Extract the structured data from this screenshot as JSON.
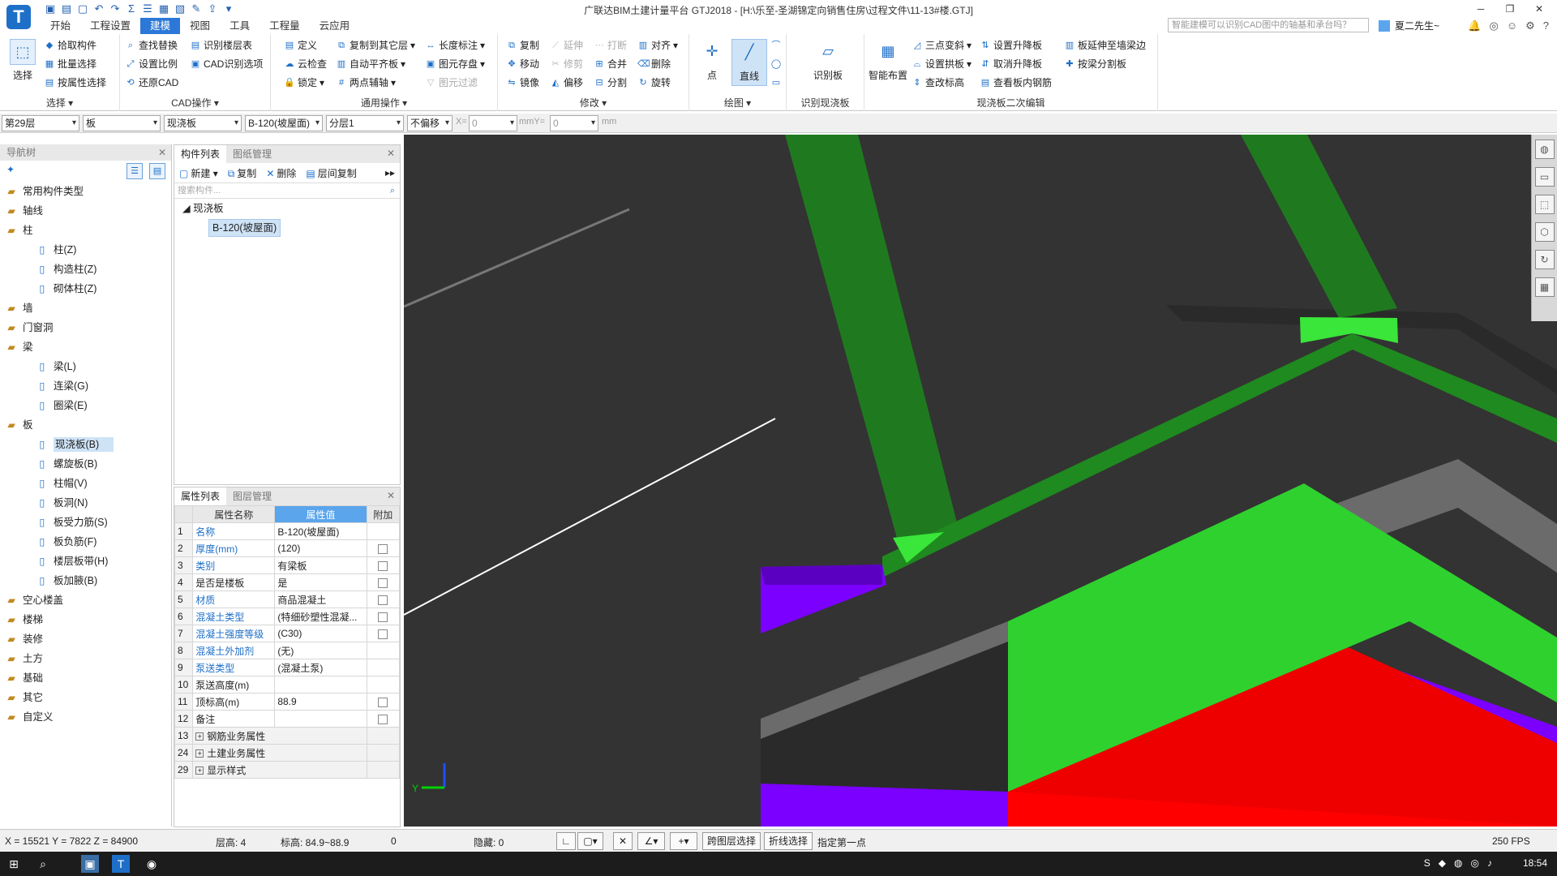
{
  "title": "广联达BIM土建计量平台 GTJ2018 - [H:\\乐至-圣湖锦定向销售住房\\过程文件\\11-13#楼.GTJ]",
  "logo": "T",
  "qat_icons": [
    "save-icon",
    "open-icon",
    "new-icon",
    "undo-icon",
    "redo-icon",
    "sum-icon",
    "list-icon",
    "calc-icon",
    "report-icon",
    "edit-icon",
    "export-icon",
    "more-icon"
  ],
  "menu_tabs": [
    "开始",
    "工程设置",
    "建模",
    "视图",
    "工具",
    "工程量",
    "云应用"
  ],
  "active_tab": "建模",
  "search_placeholder": "智能建模可以识别CAD图中的轴基和承台吗？",
  "user_name": "夏二先生~",
  "ribbon": {
    "select": {
      "label": "选择",
      "big": "选择",
      "items": [
        "拾取构件",
        "批量选择",
        "按属性选择"
      ]
    },
    "cad": {
      "label": "CAD操作",
      "items": [
        "查找替换",
        "设置比例",
        "还原CAD",
        "识别楼层表",
        "CAD识别选项"
      ]
    },
    "common": {
      "label": "通用操作",
      "items": [
        "定义",
        "云检查",
        "锁定",
        "复制到其它层",
        "自动平齐板",
        "两点辅轴",
        "长度标注",
        "图元存盘",
        "图元过滤"
      ]
    },
    "modify": {
      "label": "修改",
      "items": [
        "复制",
        "移动",
        "镜像",
        "延伸",
        "修剪",
        "偏移",
        "打断",
        "合并",
        "分割",
        "对齐",
        "删除",
        "旋转"
      ]
    },
    "draw": {
      "label": "绘图",
      "point": "点",
      "line": "直线"
    },
    "identify": {
      "label": "识别现浇板",
      "big": "识别板"
    },
    "edit2": {
      "label": "现浇板二次编辑",
      "big": "智能布置",
      "items": [
        "三点变斜",
        "设置拱板",
        "查改标高",
        "设置升降板",
        "取消升降板",
        "查看板内钢筋",
        "板延伸至墙梁边",
        "按梁分割板"
      ]
    }
  },
  "filter": {
    "floor": "第29层",
    "type": "板",
    "subtype": "现浇板",
    "component": "B-120(坡屋面)",
    "layer": "分层1",
    "offset": "不偏移",
    "x_label": "X=",
    "x_val": "0",
    "y_label": "mmY=",
    "y_val": "0",
    "mm": "mm"
  },
  "nav": {
    "title": "导航树",
    "items": [
      {
        "label": "常用构件类型",
        "level": 0
      },
      {
        "label": "轴线",
        "level": 0
      },
      {
        "label": "柱",
        "level": 0
      },
      {
        "label": "柱(Z)",
        "level": 1
      },
      {
        "label": "构造柱(Z)",
        "level": 1
      },
      {
        "label": "砌体柱(Z)",
        "level": 1
      },
      {
        "label": "墙",
        "level": 0
      },
      {
        "label": "门窗洞",
        "level": 0
      },
      {
        "label": "梁",
        "level": 0
      },
      {
        "label": "梁(L)",
        "level": 1
      },
      {
        "label": "连梁(G)",
        "level": 1
      },
      {
        "label": "圈梁(E)",
        "level": 1
      },
      {
        "label": "板",
        "level": 0
      },
      {
        "label": "现浇板(B)",
        "level": 1,
        "selected": true
      },
      {
        "label": "螺旋板(B)",
        "level": 1
      },
      {
        "label": "柱帽(V)",
        "level": 1
      },
      {
        "label": "板洞(N)",
        "level": 1
      },
      {
        "label": "板受力筋(S)",
        "level": 1
      },
      {
        "label": "板负筋(F)",
        "level": 1
      },
      {
        "label": "楼层板带(H)",
        "level": 1
      },
      {
        "label": "板加腋(B)",
        "level": 1
      },
      {
        "label": "空心楼盖",
        "level": 0
      },
      {
        "label": "楼梯",
        "level": 0
      },
      {
        "label": "装修",
        "level": 0
      },
      {
        "label": "土方",
        "level": 0
      },
      {
        "label": "基础",
        "level": 0
      },
      {
        "label": "其它",
        "level": 0
      },
      {
        "label": "自定义",
        "level": 0
      }
    ]
  },
  "complist": {
    "tabs": [
      "构件列表",
      "图纸管理"
    ],
    "tools": [
      "新建",
      "复制",
      "删除",
      "层间复制"
    ],
    "search": "搜索构件...",
    "group": "现浇板",
    "item": "B-120(坡屋面)"
  },
  "props": {
    "tabs": [
      "属性列表",
      "图层管理"
    ],
    "headers": [
      "属性名称",
      "属性值",
      "附加"
    ],
    "rows": [
      {
        "n": "1",
        "name": "名称",
        "val": "B-120(坡屋面)",
        "blue": true,
        "chk": false
      },
      {
        "n": "2",
        "name": "厚度(mm)",
        "val": "(120)",
        "blue": true,
        "chk": true
      },
      {
        "n": "3",
        "name": "类别",
        "val": "有梁板",
        "blue": true,
        "chk": true
      },
      {
        "n": "4",
        "name": "是否是楼板",
        "val": "是",
        "blue": false,
        "chk": true
      },
      {
        "n": "5",
        "name": "材质",
        "val": "商品混凝土",
        "blue": true,
        "chk": true
      },
      {
        "n": "6",
        "name": "混凝土类型",
        "val": "(特细砂塑性混凝...",
        "blue": true,
        "chk": true
      },
      {
        "n": "7",
        "name": "混凝土强度等级",
        "val": "(C30)",
        "blue": true,
        "chk": true
      },
      {
        "n": "8",
        "name": "混凝土外加剂",
        "val": "(无)",
        "blue": true,
        "chk": false
      },
      {
        "n": "9",
        "name": "泵送类型",
        "val": "(混凝土泵)",
        "blue": true,
        "chk": false
      },
      {
        "n": "10",
        "name": "泵送高度(m)",
        "val": "",
        "blue": false,
        "chk": false
      },
      {
        "n": "11",
        "name": "顶标高(m)",
        "val": "88.9",
        "blue": false,
        "chk": true
      },
      {
        "n": "12",
        "name": "备注",
        "val": "",
        "blue": false,
        "chk": true
      }
    ],
    "groups": [
      {
        "n": "13",
        "name": "钢筋业务属性"
      },
      {
        "n": "24",
        "name": "土建业务属性"
      },
      {
        "n": "29",
        "name": "显示样式"
      }
    ]
  },
  "axes": {
    "y": "Y"
  },
  "status": {
    "coords": "X = 15521 Y = 7822 Z = 84900",
    "floor_h": "层高:   4",
    "elev": "标高:   84.9~88.9",
    "zero": "0",
    "hidden": "隐藏:  0",
    "btn1": "跨图层选择",
    "btn2": "折线选择",
    "hint": "指定第一点",
    "fps": "250 FPS"
  },
  "taskbar": {
    "time": "18:54"
  },
  "colors": {
    "beam": "#1f7a1f",
    "beam_end": "#39e639",
    "slab": "#2fd12f",
    "purple": "#7b00ff",
    "red": "#ff0000",
    "gray": "#6b6b6b",
    "bg": "#333333",
    "accent": "#2b78d8"
  }
}
